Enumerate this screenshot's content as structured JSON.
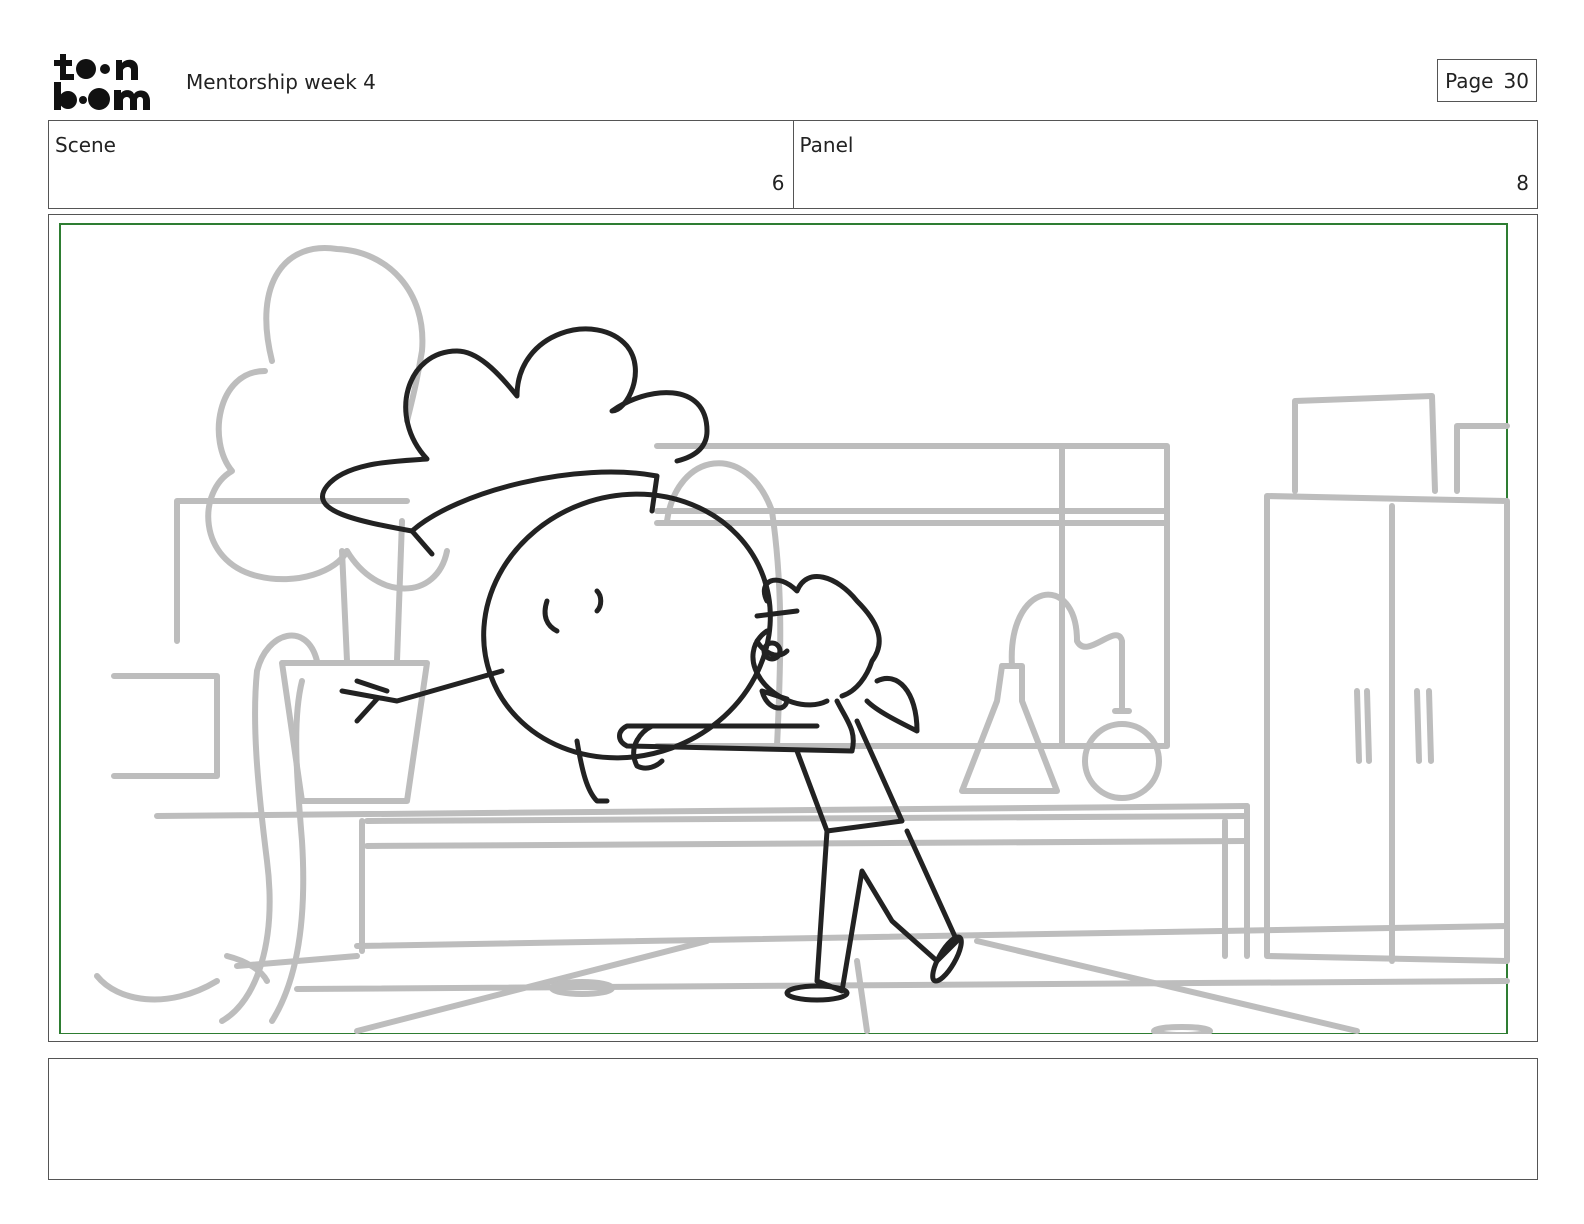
{
  "header": {
    "logo_text_top": "toon",
    "logo_text_bottom": "boom",
    "title": "Mentorship week 4",
    "page_label": "Page",
    "page_number": "30"
  },
  "info": {
    "scene_label": "Scene",
    "scene_value": "6",
    "panel_label": "Panel",
    "panel_value": "8"
  },
  "panel": {
    "safe_frame_color": "#2e7d32",
    "background_line_color": "#bdbdbd",
    "character_line_color": "#222222"
  },
  "notes": {
    "text": ""
  }
}
